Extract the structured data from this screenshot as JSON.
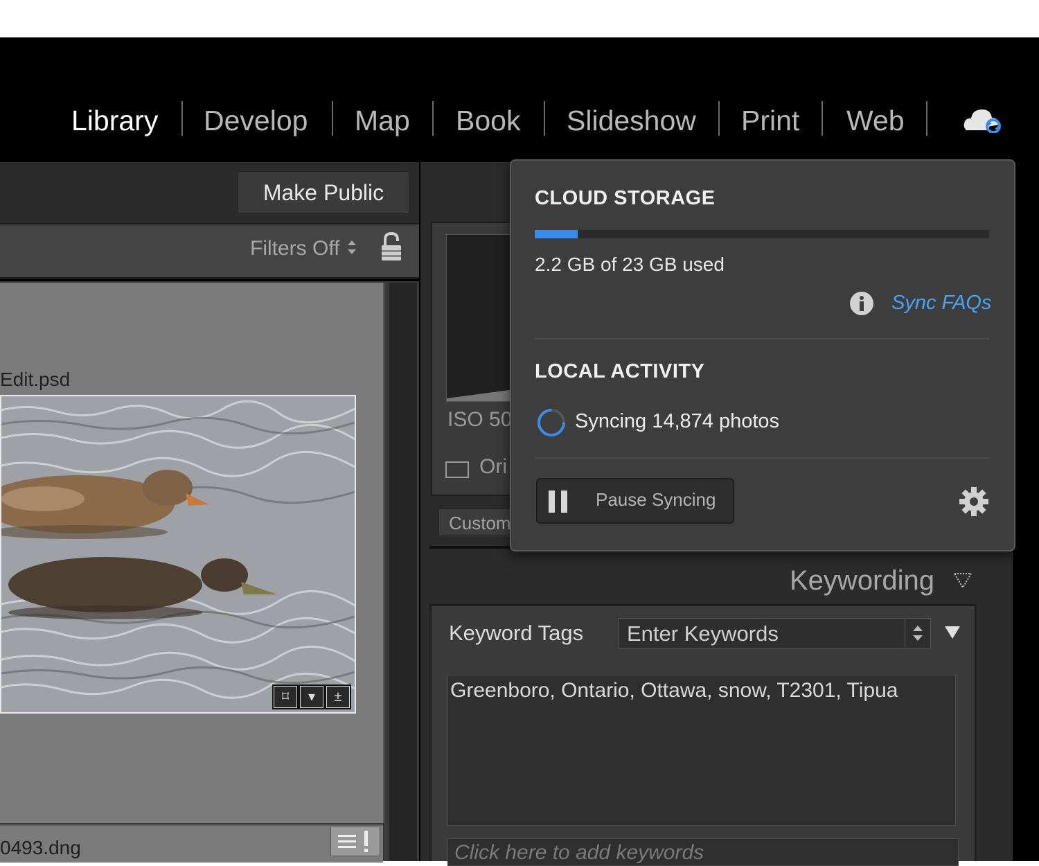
{
  "modules": [
    {
      "label": "Library",
      "active": true
    },
    {
      "label": "Develop",
      "active": false
    },
    {
      "label": "Map",
      "active": false
    },
    {
      "label": "Book",
      "active": false
    },
    {
      "label": "Slideshow",
      "active": false
    },
    {
      "label": "Print",
      "active": false
    },
    {
      "label": "Web",
      "active": false
    }
  ],
  "toolbar": {
    "make_public_label": "Make Public"
  },
  "filter_bar": {
    "filters_label": "Filters Off",
    "filters_arrows": "⬍"
  },
  "grid": {
    "cell_1_filename": "Edit.psd",
    "cell_2_filename": "0493.dng"
  },
  "histogram_panel": {
    "iso": "ISO 50",
    "original_label": "Ori",
    "custom_label": "Custom"
  },
  "keywording": {
    "header": "Keywording",
    "tags_label": "Keyword Tags",
    "select_value": "Enter Keywords",
    "keywords_text": "Greenboro, Ontario, Ottawa, snow, T2301, Tipua",
    "add_placeholder": "Click here to add keywords"
  },
  "sync_popover": {
    "cloud_storage_title": "CLOUD STORAGE",
    "storage_used_fraction": 0.095,
    "storage_used_text": "2.2 GB of 23 GB used",
    "sync_faqs_link": "Sync FAQs",
    "local_activity_title": "LOCAL ACTIVITY",
    "syncing_text": "Syncing 14,874 photos",
    "pause_label": "Pause Syncing"
  },
  "icons": {
    "cloud": "cloud-sync-icon",
    "lock": "padlock-icon",
    "info": "info-icon",
    "spinner": "spinner-icon",
    "pause": "pause-icon",
    "gear": "gear-icon"
  },
  "colors": {
    "accent": "#3b8be8",
    "link": "#4aa3f0"
  }
}
